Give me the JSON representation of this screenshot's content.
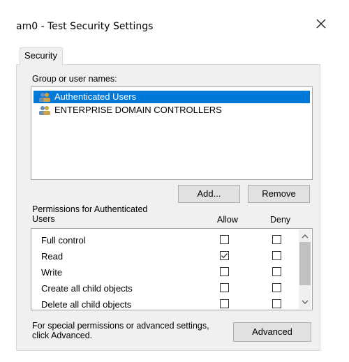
{
  "window": {
    "title": "am0 - Test Security Settings"
  },
  "tabs": [
    {
      "label": "Security"
    }
  ],
  "group_section": {
    "label": "Group or user names:",
    "users": [
      {
        "name": "Authenticated Users",
        "selected": true
      },
      {
        "name": "ENTERPRISE DOMAIN CONTROLLERS",
        "selected": false
      }
    ],
    "add_button": "Add...",
    "remove_button": "Remove"
  },
  "permissions": {
    "label": "Permissions for Authenticated Users",
    "allow_header": "Allow",
    "deny_header": "Deny",
    "rows": [
      {
        "name": "Full control",
        "allow": false,
        "deny": false
      },
      {
        "name": "Read",
        "allow": true,
        "deny": false
      },
      {
        "name": "Write",
        "allow": false,
        "deny": false
      },
      {
        "name": "Create all child objects",
        "allow": false,
        "deny": false
      },
      {
        "name": "Delete all child objects",
        "allow": false,
        "deny": false
      }
    ]
  },
  "footer": {
    "text": "For special permissions or advanced settings, click Advanced.",
    "advanced_button": "Advanced"
  },
  "colors": {
    "selection": "#0078d7",
    "panel": "#f0f0f0",
    "button": "#e1e1e1"
  },
  "icons": {
    "close": "close-icon",
    "user_group": "users-icon",
    "scroll_up": "chevron-up-icon",
    "scroll_down": "chevron-down-icon"
  }
}
